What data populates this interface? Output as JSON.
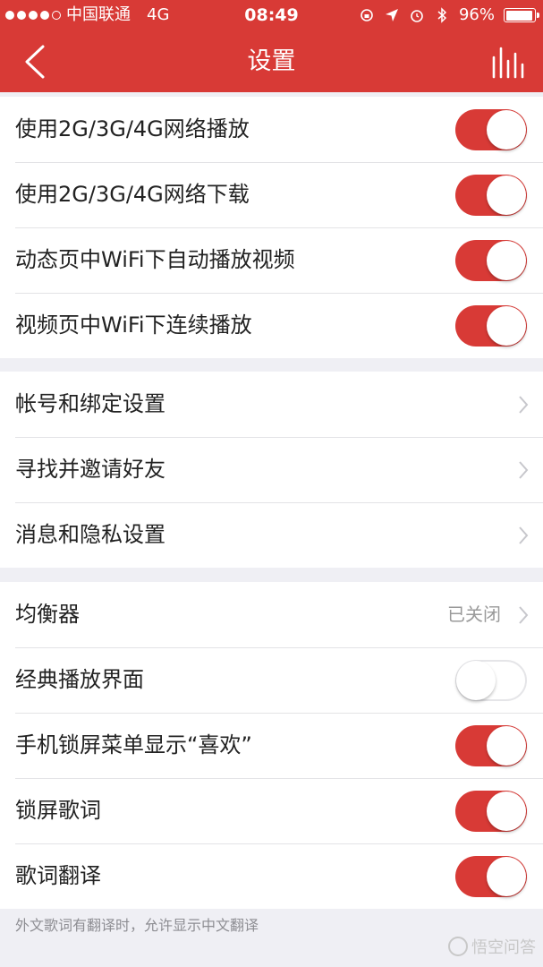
{
  "status_bar": {
    "carrier": "中国联通",
    "network": "4G",
    "time": "08:49",
    "battery": "96%",
    "battery_level": 0.96
  },
  "navbar": {
    "title": "设置"
  },
  "section1": {
    "items": [
      {
        "label": "使用2G/3G/4G网络播放",
        "on": true
      },
      {
        "label": "使用2G/3G/4G网络下载",
        "on": true
      },
      {
        "label": "动态页中WiFi下自动播放视频",
        "on": true
      },
      {
        "label": "视频页中WiFi下连续播放",
        "on": true
      }
    ]
  },
  "section2": {
    "items": [
      {
        "label": "帐号和绑定设置"
      },
      {
        "label": "寻找并邀请好友"
      },
      {
        "label": "消息和隐私设置"
      }
    ]
  },
  "section3": {
    "equalizer": {
      "label": "均衡器",
      "value": "已关闭"
    },
    "items": [
      {
        "label": "经典播放界面",
        "on": false
      },
      {
        "label": "手机锁屏菜单显示“喜欢”",
        "on": true
      },
      {
        "label": "锁屏歌词",
        "on": true
      },
      {
        "label": "歌词翻译",
        "on": true
      }
    ]
  },
  "footnote": "外文歌词有翻译时，允许显示中文翻译",
  "watermark": "悟空问答",
  "colors": {
    "accent": "#d83a36",
    "background": "#efeff4"
  }
}
